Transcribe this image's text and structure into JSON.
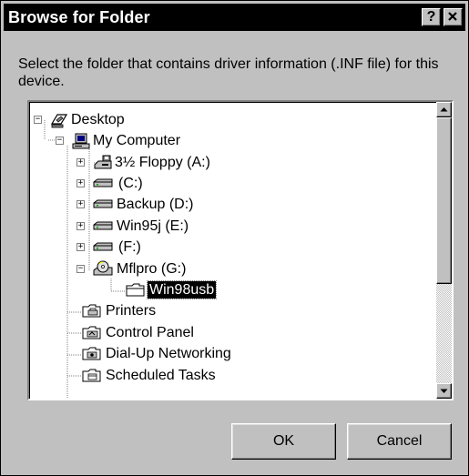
{
  "window": {
    "title": "Browse for Folder",
    "help_label": "?",
    "close_label": "✕"
  },
  "prompt": "Select the folder that contains driver information (.INF file) for this device.",
  "tree": {
    "items": [
      {
        "label": "Desktop",
        "icon": "desktop-icon",
        "expander": "−"
      },
      {
        "label": "My Computer",
        "icon": "computer-icon",
        "expander": "−"
      },
      {
        "label": "3½ Floppy (A:)",
        "icon": "floppy-drive-icon",
        "expander": "+"
      },
      {
        "label": "(C:)",
        "icon": "hard-drive-icon",
        "expander": "+"
      },
      {
        "label": "Backup (D:)",
        "icon": "hard-drive-icon",
        "expander": "+"
      },
      {
        "label": "Win95j (E:)",
        "icon": "hard-drive-icon",
        "expander": "+"
      },
      {
        "label": "(F:)",
        "icon": "hard-drive-icon",
        "expander": "+"
      },
      {
        "label": "Mflpro (G:)",
        "icon": "cd-drive-icon",
        "expander": "−"
      },
      {
        "label": "Win98usb",
        "icon": "folder-icon",
        "selected": true
      },
      {
        "label": "Printers",
        "icon": "printers-folder-icon"
      },
      {
        "label": "Control Panel",
        "icon": "control-panel-icon"
      },
      {
        "label": "Dial-Up Networking",
        "icon": "dialup-networking-icon"
      },
      {
        "label": "Scheduled Tasks",
        "icon": "scheduled-tasks-icon"
      }
    ]
  },
  "buttons": {
    "ok": "OK",
    "cancel": "Cancel"
  },
  "scrollbar": {
    "up_icon": "scroll-up-arrow-icon",
    "down_icon": "scroll-down-arrow-icon"
  }
}
